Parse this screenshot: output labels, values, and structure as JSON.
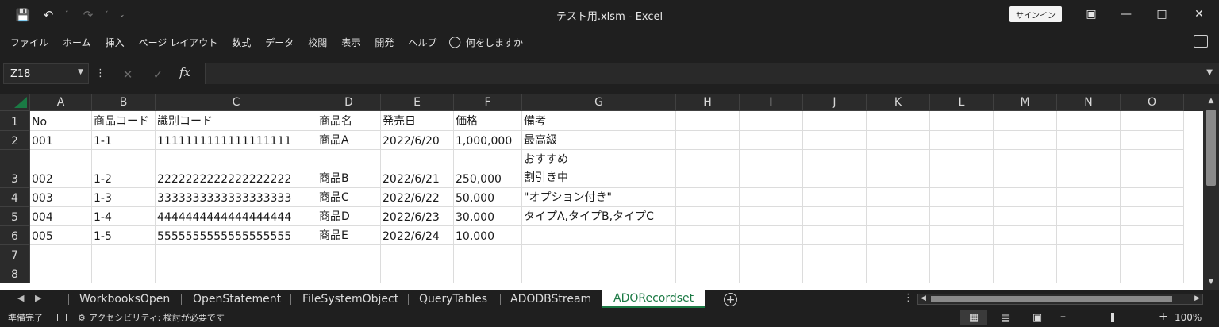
{
  "window": {
    "title": "テスト用.xlsm  -  Excel",
    "signin_label": "サインイン"
  },
  "qat": {
    "save_icon": "save-icon",
    "undo_icon": "undo-icon",
    "redo_icon": "redo-icon"
  },
  "menu": {
    "items": [
      "ファイル",
      "ホーム",
      "挿入",
      "ページ レイアウト",
      "数式",
      "データ",
      "校閲",
      "表示",
      "開発",
      "ヘルプ"
    ],
    "tell_me": "何をしますか"
  },
  "formula_bar": {
    "name_box": "Z18",
    "fx_label": "fx",
    "formula": ""
  },
  "columns": [
    "A",
    "B",
    "C",
    "D",
    "E",
    "F",
    "G",
    "H",
    "I",
    "J",
    "K",
    "L",
    "M",
    "N",
    "O"
  ],
  "rows": [
    {
      "num": "1",
      "cells": [
        "No",
        "商品コード",
        "識別コード",
        "商品名",
        "発売日",
        "価格",
        "備考"
      ]
    },
    {
      "num": "2",
      "cells": [
        "001",
        "1-1",
        "1111111111111111111",
        "商品A",
        "2022/6/20",
        "1,000,000",
        "最高級"
      ]
    },
    {
      "num": "3",
      "cells": [
        "002",
        "1-2",
        "2222222222222222222",
        "商品B",
        "2022/6/21",
        "250,000",
        [
          "おすすめ",
          "割引き中"
        ]
      ]
    },
    {
      "num": "4",
      "cells": [
        "003",
        "1-3",
        "3333333333333333333",
        "商品C",
        "2022/6/22",
        "50,000",
        "\"オプション付き\""
      ]
    },
    {
      "num": "5",
      "cells": [
        "004",
        "1-4",
        "4444444444444444444",
        "商品D",
        "2022/6/23",
        "30,000",
        "タイプA,タイプB,タイプC"
      ]
    },
    {
      "num": "6",
      "cells": [
        "005",
        "1-5",
        "5555555555555555555",
        "商品E",
        "2022/6/24",
        "10,000",
        ""
      ]
    },
    {
      "num": "7",
      "cells": []
    },
    {
      "num": "8",
      "cells": []
    }
  ],
  "sheet_tabs": [
    "WorkbooksOpen",
    "OpenStatement",
    "FileSystemObject",
    "QueryTables",
    "ADODBStream",
    "ADORecordset"
  ],
  "active_tab": "ADORecordset",
  "status": {
    "ready": "準備完了",
    "accessibility": "アクセシビリティ: 検討が必要です",
    "zoom": "100%"
  },
  "colors": {
    "accent": "#1c7a45",
    "chrome": "#1f1f1f"
  }
}
